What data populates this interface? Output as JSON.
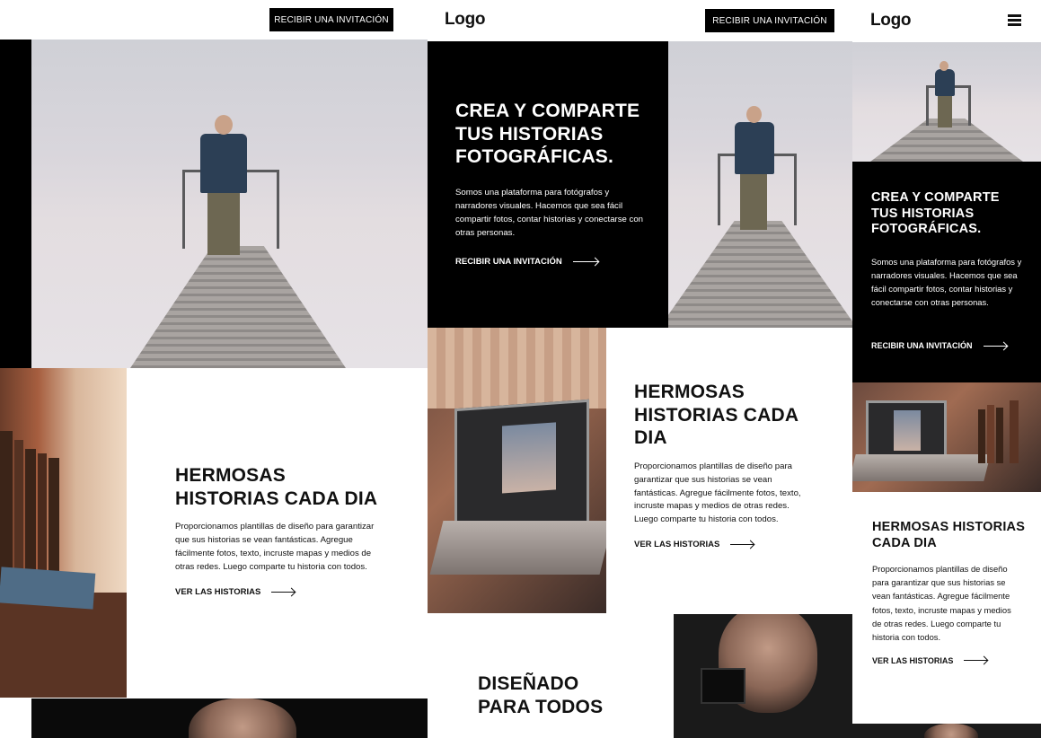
{
  "common": {
    "invite_button": "RECIBIR UNA INVITACIÓN",
    "logo": "Logo",
    "hero_title": "CREA Y COMPARTE TUS HISTORIAS FOTOGRÁFICAS.",
    "hero_body": "Somos una plataforma para fotógrafos y narradores visuales. Hacemos que sea fácil compartir fotos, contar historias y conectarse con otras personas.",
    "hero_cta": "RECIBIR UNA INVITACIÓN",
    "stories_title": "HERMOSAS HISTORIAS CADA DIA",
    "stories_body": "Proporcionamos plantillas de diseño para garantizar que sus historias se vean fantásticas. Agregue fácilmente fotos, texto, incruste mapas y medios de otras redes. Luego comparte tu historia con todos.",
    "stories_cta": "VER LAS HISTORIAS",
    "designed_title": "DISEÑADO PARA TODOS"
  },
  "icons": {
    "menu": "hamburger-menu-icon",
    "arrow": "arrow-right-icon"
  },
  "colors": {
    "black": "#000000",
    "white": "#ffffff",
    "text": "#111111"
  }
}
